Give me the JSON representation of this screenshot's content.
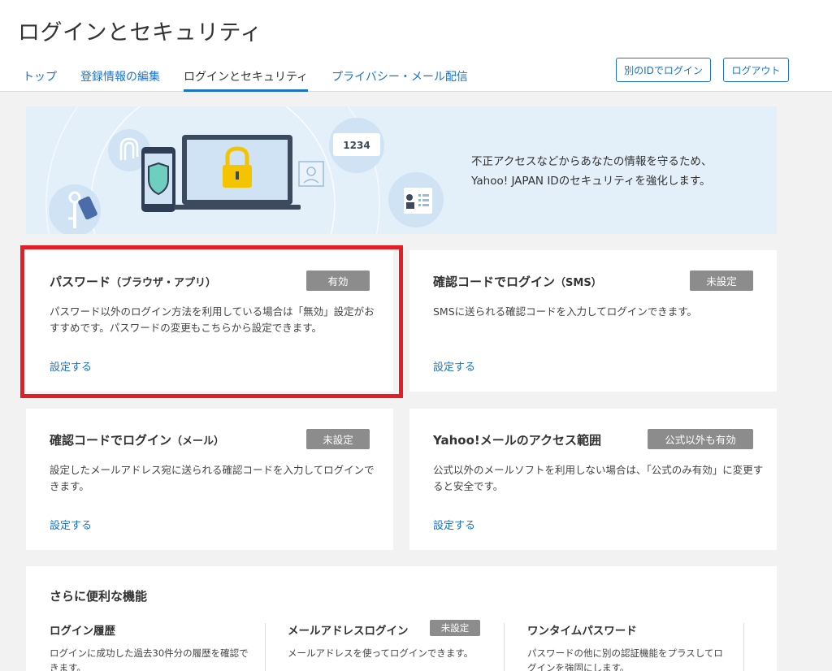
{
  "header": {
    "title": "ログインとセキュリティ",
    "tabs": [
      {
        "label": "トップ"
      },
      {
        "label": "登録情報の編集"
      },
      {
        "label": "ログインとセキュリティ",
        "active": true
      },
      {
        "label": "プライバシー・メール配信"
      }
    ],
    "alt_login_label": "別のIDでログイン",
    "logout_label": "ログアウト"
  },
  "hero": {
    "line1": "不正アクセスなどからあなたの情報を守るため、",
    "line2": "Yahoo! JAPAN IDのセキュリティを強化します。",
    "pin_text": "1234"
  },
  "cards": [
    {
      "title": "パスワード",
      "title_sub": "（ブラウザ・アプリ）",
      "status": "有効",
      "desc": "パスワード以外のログイン方法を利用している場合は「無効」設定がおすすめです。パスワードの変更もこちらから設定できます。",
      "link": "設定する",
      "highlighted": true
    },
    {
      "title": "確認コードでログイン",
      "title_sub": "（SMS）",
      "status": "未設定",
      "desc": "SMSに送られる確認コードを入力してログインできます。",
      "link": "設定する"
    },
    {
      "title": "確認コードでログイン",
      "title_sub": "（メール）",
      "status": "未設定",
      "desc": "設定したメールアドレス宛に送られる確認コードを入力してログインできます。",
      "link": "設定する"
    },
    {
      "title": "Yahoo!メールのアクセス範囲",
      "title_sub": "",
      "status": "公式以外も有効",
      "desc": "公式以外のメールソフトを利用しない場合は、「公式のみ有効」に変更すると安全です。",
      "link": "設定する"
    }
  ],
  "more": {
    "title": "さらに便利な機能",
    "features": [
      {
        "title": "ログイン履歴",
        "desc": "ログインに成功した過去30件分の履歴を確認できます。"
      },
      {
        "title": "メールアドレスログイン",
        "badge": "未設定",
        "desc": "メールアドレスを使ってログインできます。"
      },
      {
        "title": "ワンタイムパスワード",
        "desc": "パスワードの他に別の認証機能をプラスしてログインを強固にします。"
      }
    ]
  },
  "colors": {
    "accent": "#1a73c9",
    "badge": "#8c8c8c",
    "highlight": "#e41e26",
    "hero_bg": "#e3eff9",
    "lock": "#f5c400"
  }
}
